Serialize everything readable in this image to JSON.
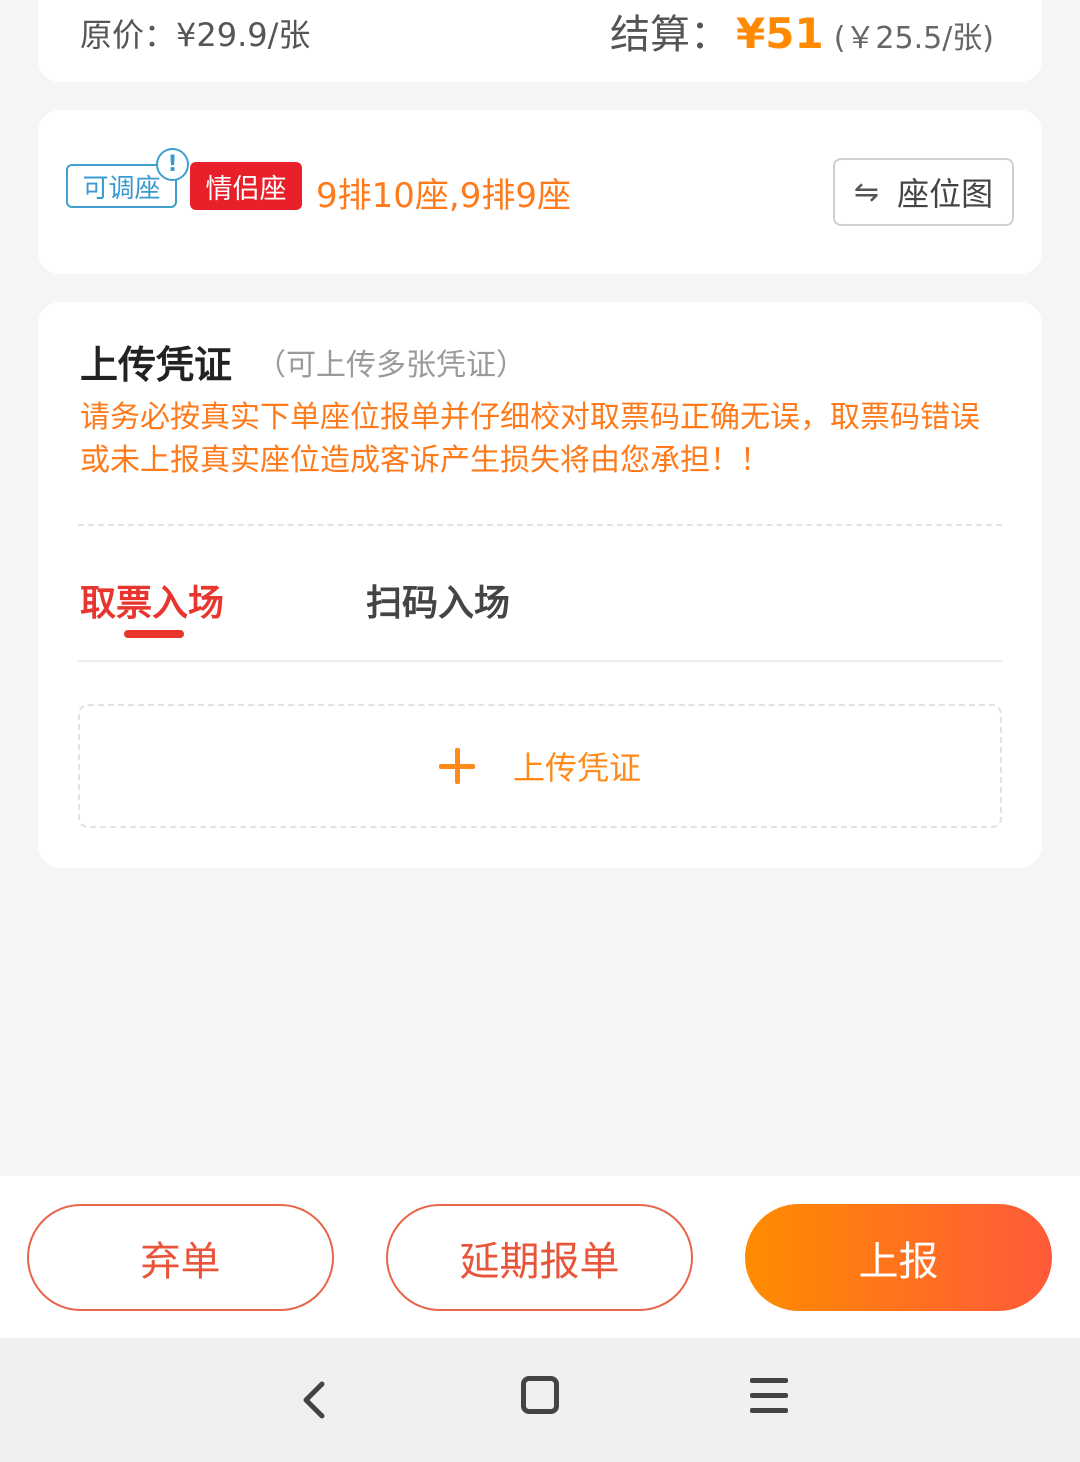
{
  "price": {
    "original": "原价：¥29.9/张",
    "settle_label": "结算：",
    "settle_amount": "¥51",
    "settle_unit": "(￥25.5/张)"
  },
  "seat": {
    "adjustable_tag": "可调座",
    "warning_icon": "!",
    "couple_tag": "情侣座",
    "seats": "9排10座,9排9座",
    "seat_map_button": "座位图",
    "swap_icon": "⇋"
  },
  "upload": {
    "title": "上传凭证",
    "subtitle": "（可上传多张凭证）",
    "warning": "请务必按真实下单座位报单并仔细校对取票码正确无误，取票码错误或未上报真实座位造成客诉产生损失将由您承担！！",
    "tabs": [
      "取票入场",
      "扫码入场"
    ],
    "upload_button": "上传凭证"
  },
  "actions": {
    "abandon": "弃单",
    "delay": "延期报单",
    "report": "上报"
  },
  "colors": {
    "accent_orange": "#ff7a1a",
    "active_red": "#e8362f",
    "couple_red": "#e8202a",
    "adjust_blue": "#3b9bd0"
  },
  "icons": [
    "swap-icon",
    "warning-icon",
    "plus-icon",
    "back-icon",
    "home-icon",
    "menu-icon"
  ]
}
